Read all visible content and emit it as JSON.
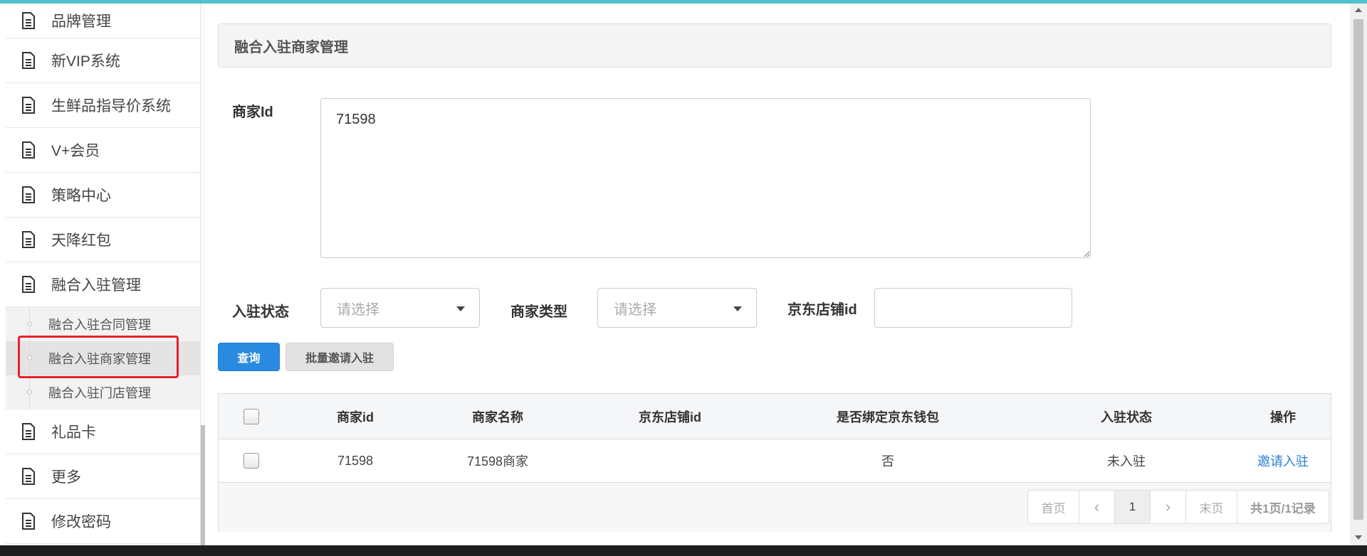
{
  "sidebar": {
    "items_top": [
      {
        "label": "品牌管理",
        "icon": "document-icon"
      },
      {
        "label": "新VIP系统",
        "icon": "document-icon"
      },
      {
        "label": "生鲜品指导价系统",
        "icon": "document-icon"
      },
      {
        "label": "V+会员",
        "icon": "document-icon"
      },
      {
        "label": "策略中心",
        "icon": "document-icon"
      },
      {
        "label": "天降红包",
        "icon": "document-icon"
      },
      {
        "label": "融合入驻管理",
        "icon": "document-icon"
      }
    ],
    "sub_items": [
      {
        "label": "融合入驻合同管理"
      },
      {
        "label": "融合入驻商家管理",
        "active": true
      },
      {
        "label": "融合入驻门店管理"
      }
    ],
    "items_bottom": [
      {
        "label": "礼品卡",
        "icon": "document-icon"
      },
      {
        "label": "更多",
        "icon": "document-icon"
      },
      {
        "label": "修改密码",
        "icon": "document-icon"
      }
    ]
  },
  "panel": {
    "title": "融合入驻商家管理"
  },
  "form": {
    "merchant_id_label": "商家Id",
    "merchant_id_value": "71598",
    "status_label": "入驻状态",
    "status_placeholder": "请选择",
    "type_label": "商家类型",
    "type_placeholder": "请选择",
    "jd_shop_label": "京东店铺id",
    "jd_shop_value": "",
    "query_button": "查询",
    "batch_invite_button": "批量邀请入驻"
  },
  "table": {
    "headers": [
      "商家id",
      "商家名称",
      "京东店铺id",
      "是否绑定京东钱包",
      "入驻状态",
      "操作"
    ],
    "rows": [
      {
        "merchant_id": "71598",
        "merchant_name": "71598商家",
        "jd_shop_id": "",
        "bound_wallet": "否",
        "status": "未入驻",
        "action": "邀请入驻"
      }
    ]
  },
  "pagination": {
    "first": "首页",
    "prev": "‹",
    "current": "1",
    "next": "›",
    "last": "末页",
    "summary": "共1页/1记录"
  },
  "colors": {
    "accent_top": "#4fc3cc",
    "primary_button": "#2a8ae0",
    "link": "#2a7fd6",
    "highlight": "#e8202a"
  }
}
